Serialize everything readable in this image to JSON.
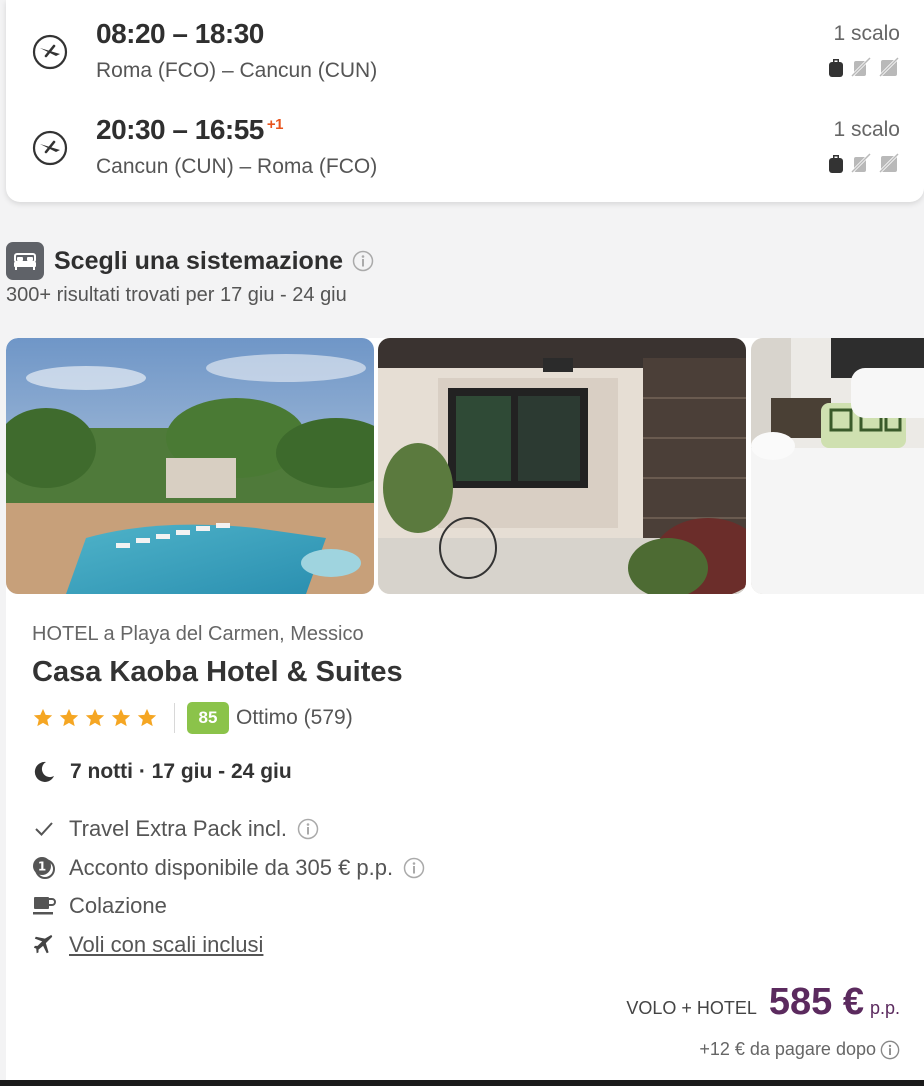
{
  "flights": [
    {
      "times": "08:20 – 18:30",
      "plus_day": "",
      "route": "Roma (FCO) – Cancun (CUN)",
      "stops": "1 scalo"
    },
    {
      "times": "20:30 – 16:55",
      "plus_day": "+1",
      "route": "Cancun (CUN) – Roma (FCO)",
      "stops": "1 scalo"
    }
  ],
  "accommodation": {
    "title": "Scegli una sistemazione",
    "subtitle": "300+ risultati trovati per 17 giu - 24 giu"
  },
  "hotel": {
    "location": "HOTEL a Playa del Carmen, Messico",
    "name": "Casa Kaoba Hotel & Suites",
    "stars": 5,
    "score": "85",
    "score_label": "Ottimo (579)",
    "nights": "7 notti · 17 giu - 24 giu",
    "features": [
      {
        "icon": "check-icon",
        "text": "Travel Extra Pack incl."
      },
      {
        "icon": "deposit-icon",
        "text": "Acconto disponibile da 305 € p.p."
      },
      {
        "icon": "coffee-icon",
        "text": "Colazione"
      },
      {
        "icon": "plane-icon",
        "text": "Voli con scali inclusi"
      }
    ],
    "price_label": "VOLO + HOTEL",
    "price": "585 €",
    "price_unit": "p.p.",
    "pay_later": "+12 € da pagare dopo"
  },
  "colors": {
    "accent_price": "#5b2a5e",
    "score_badge": "#8bc34a",
    "plus_day": "#e8541e",
    "star": "#f5a623"
  }
}
